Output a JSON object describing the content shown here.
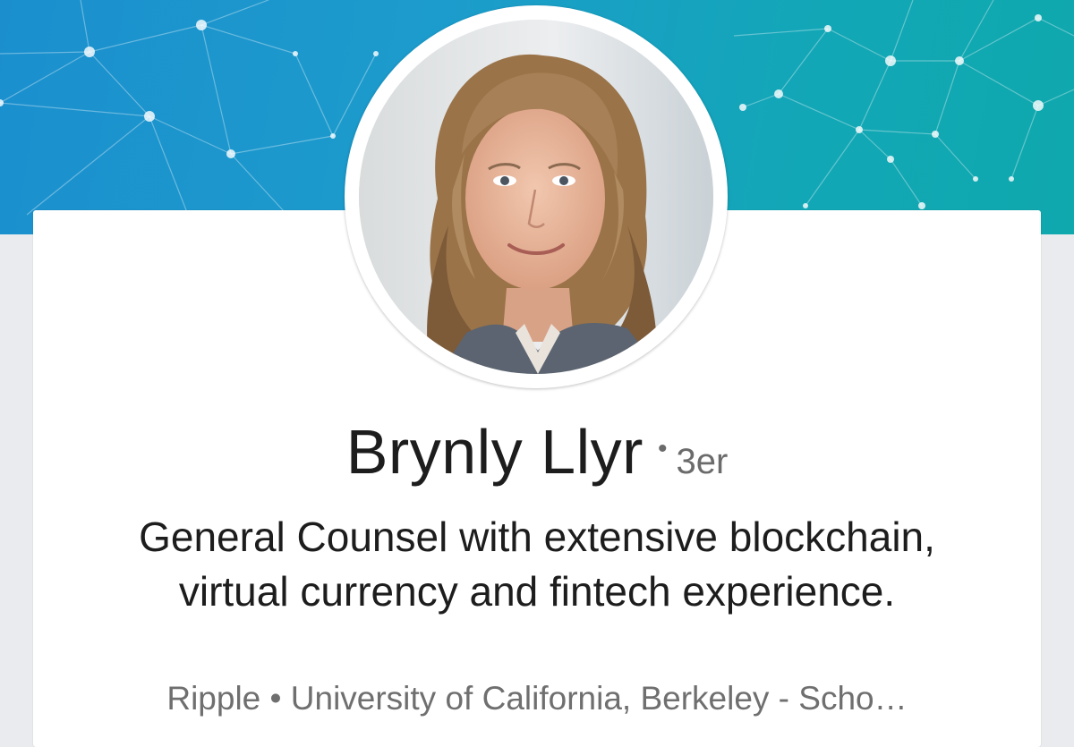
{
  "profile": {
    "name": "Brynly Llyr",
    "degree": "3er",
    "separator": "•",
    "headline": "General Counsel with extensive blockchain, virtual currency and fintech experience.",
    "subline": "Ripple • University of California, Berkeley - Scho…"
  },
  "colors": {
    "banner_start": "#1b8fce",
    "banner_end": "#0fa8ad",
    "card": "#ffffff",
    "page_bg": "#e9ebee"
  },
  "icons": {
    "avatar": "profile-photo"
  }
}
